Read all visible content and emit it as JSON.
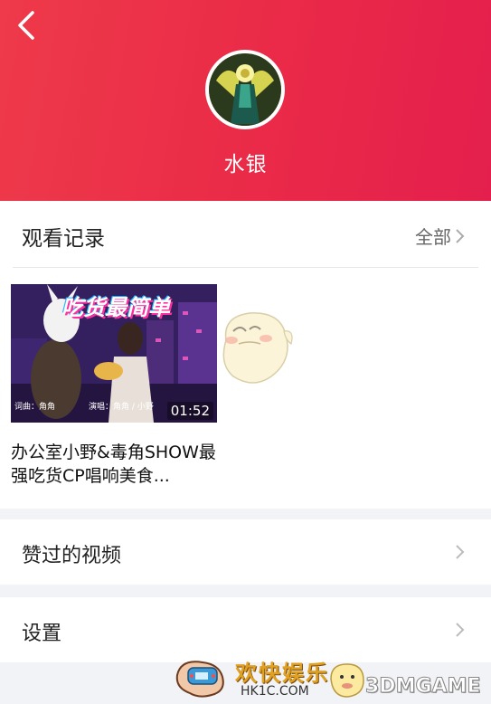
{
  "header": {
    "back_icon": "chevron-left-icon",
    "username": "水银",
    "gradient_start": "#ee3a4a",
    "gradient_end": "#e41f4d"
  },
  "history": {
    "title": "观看记录",
    "all_label": "全部",
    "videos": [
      {
        "title": "办公室小野&毒角SHOW最强吃货CP唱响美食...",
        "duration": "01:52",
        "thumb_banner": "吃货最简单",
        "thumb_credit_left": "词曲：角角",
        "thumb_credit_right": "演唱：角角 / 小野"
      }
    ]
  },
  "menu": {
    "liked_label": "赞过的视频",
    "settings_label": "设置"
  },
  "watermark": {
    "text_cn": "欢快娱乐",
    "text_url": "HK1C.COM",
    "text_brand": "3DMGAME"
  }
}
